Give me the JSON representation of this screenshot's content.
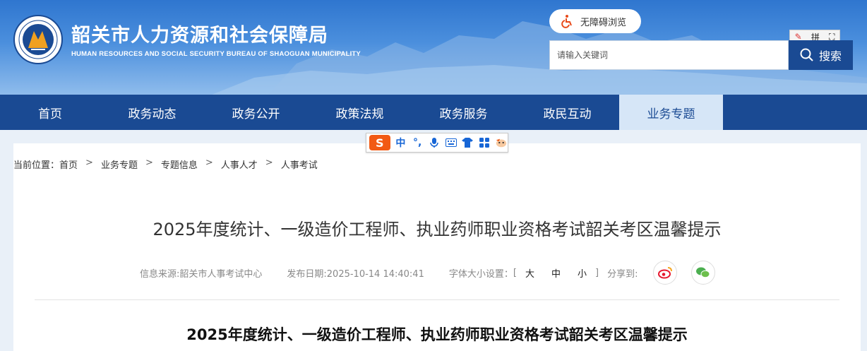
{
  "header": {
    "title": "韶关市人力资源和社会保障局",
    "subtitle": "HUMAN RESOURCES AND SOCIAL SECURITY BUREAU OF SHAOGUAN MUNICIPALITY",
    "accessibility_label": "无障碍浏览",
    "search": {
      "placeholder": "请输入关键词",
      "button_label": "搜索"
    },
    "ime_mini": {
      "pin": "拼"
    }
  },
  "nav": {
    "items": [
      {
        "label": "首页"
      },
      {
        "label": "政务动态"
      },
      {
        "label": "政务公开"
      },
      {
        "label": "政策法规"
      },
      {
        "label": "政务服务"
      },
      {
        "label": "政民互动"
      },
      {
        "label": "业务专题",
        "active": true
      }
    ]
  },
  "ime_toolbar": {
    "logo": "S",
    "mode": "中",
    "punct": "°,"
  },
  "breadcrumb": {
    "prefix": "当前位置：",
    "items": [
      "首页",
      "业务专题",
      "专题信息",
      "人事人才",
      "人事考试"
    ],
    "separator": ">"
  },
  "article": {
    "title": "2025年度统计、一级造价工程师、执业药师职业资格考试韶关考区温馨提示",
    "source": "信息来源:韶关市人事考试中心",
    "date": "发布日期:2025-10-14 14:40:41",
    "font_size_label": "字体大小设置：",
    "font_open": "[",
    "font_close": "]",
    "font_options": [
      "大",
      "中",
      "小"
    ],
    "share_label": "分享到:",
    "heading": "2025年度统计、一级造价工程师、执业药师职业资格考试韶关考区温馨提示"
  },
  "colors": {
    "nav_bg": "#1a4a93",
    "nav_active_bg": "#d6e6f7",
    "weibo": "#e6162d",
    "wechat": "#4caf50",
    "ime_orange": "#f25a14"
  }
}
